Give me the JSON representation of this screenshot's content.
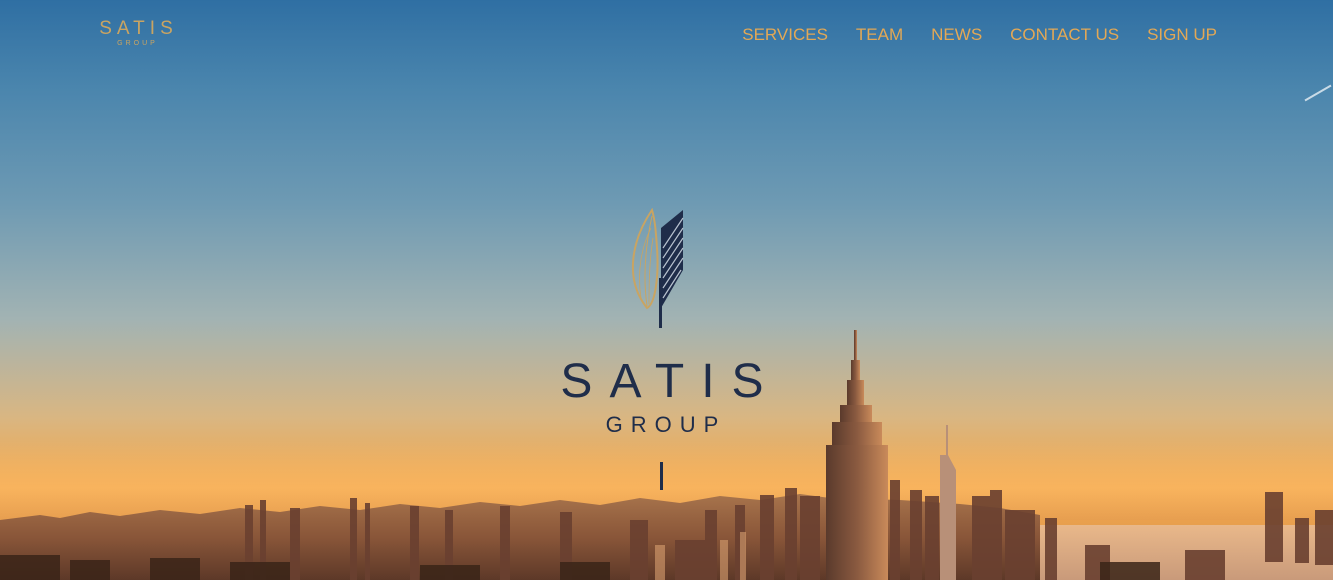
{
  "header": {
    "logo_line1": "SATIS",
    "logo_line2": "GROUP"
  },
  "nav": {
    "items": [
      {
        "label": "SERVICES"
      },
      {
        "label": "TEAM"
      },
      {
        "label": "NEWS"
      },
      {
        "label": "CONTACT US"
      },
      {
        "label": "SIGN UP"
      }
    ]
  },
  "hero": {
    "logo_line1": "SATIS",
    "logo_line2": "GROUP",
    "icon": "feather-leaf-icon"
  },
  "colors": {
    "accent_gold": "#e3a855",
    "logo_navy": "#1f2d4a",
    "header_logo_gold": "#c9a462"
  }
}
